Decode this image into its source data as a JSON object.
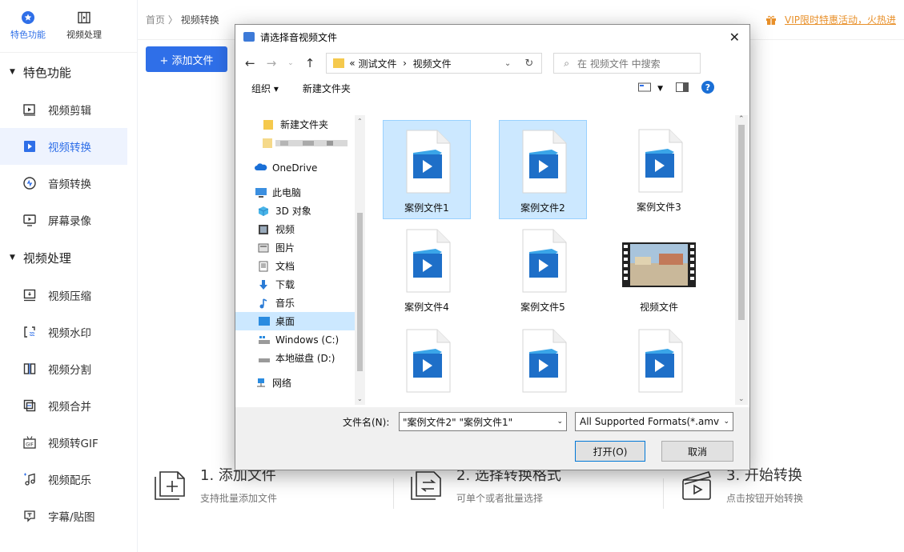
{
  "sidebar": {
    "tabs": [
      {
        "label": "特色功能",
        "icon": "star-icon"
      },
      {
        "label": "视频处理",
        "icon": "film-icon"
      }
    ],
    "section1": "特色功能",
    "section1_items": [
      {
        "label": "视频剪辑",
        "icon": "video-edit-icon"
      },
      {
        "label": "视频转换",
        "icon": "video-convert-icon"
      },
      {
        "label": "音频转换",
        "icon": "audio-convert-icon"
      },
      {
        "label": "屏幕录像",
        "icon": "screen-record-icon"
      }
    ],
    "section2": "视频处理",
    "section2_items": [
      {
        "label": "视频压缩",
        "icon": "compress-icon"
      },
      {
        "label": "视频水印",
        "icon": "watermark-icon"
      },
      {
        "label": "视频分割",
        "icon": "split-icon"
      },
      {
        "label": "视频合并",
        "icon": "merge-icon"
      },
      {
        "label": "视频转GIF",
        "icon": "gif-icon"
      },
      {
        "label": "视频配乐",
        "icon": "music-icon"
      },
      {
        "label": "字幕/贴图",
        "icon": "subtitle-icon"
      }
    ]
  },
  "header": {
    "breadcrumb_home": "首页",
    "breadcrumb_sep": "〉",
    "breadcrumb_current": "视频转换",
    "vip_text": "VIP限时特惠活动，火热进"
  },
  "main": {
    "add_file_label": "+ 添加文件",
    "steps": [
      {
        "title": "1. 添加文件",
        "desc": "支持批量添加文件"
      },
      {
        "title": "2. 选择转换格式",
        "desc": "可单个或者批量选择"
      },
      {
        "title": "3. 开始转换",
        "desc": "点击按钮开始转换"
      }
    ]
  },
  "dialog": {
    "title": "请选择音视频文件",
    "path_prefix": "«",
    "path_parts": [
      "测试文件",
      "›",
      "视频文件"
    ],
    "search_placeholder": "在 视频文件 中搜索",
    "organize_label": "组织 ▾",
    "new_folder_label": "新建文件夹",
    "tree": [
      {
        "label": "新建文件夹",
        "icon": "folder-icon"
      },
      {
        "label": "",
        "icon": "blurred-folder-icon"
      },
      {
        "label": "OneDrive",
        "icon": "cloud-icon"
      },
      {
        "label": "此电脑",
        "icon": "computer-icon"
      },
      {
        "label": "3D 对象",
        "icon": "cube-icon"
      },
      {
        "label": "视频",
        "icon": "video-folder-icon"
      },
      {
        "label": "图片",
        "icon": "picture-folder-icon"
      },
      {
        "label": "文档",
        "icon": "document-folder-icon"
      },
      {
        "label": "下载",
        "icon": "download-icon"
      },
      {
        "label": "音乐",
        "icon": "music-note-icon"
      },
      {
        "label": "桌面",
        "icon": "desktop-icon"
      },
      {
        "label": "Windows (C:)",
        "icon": "drive-c-icon"
      },
      {
        "label": "本地磁盘 (D:)",
        "icon": "drive-d-icon"
      },
      {
        "label": "网络",
        "icon": "network-icon"
      }
    ],
    "files": [
      {
        "name": "案例文件1",
        "selected": true,
        "thumb": "video-file-icon"
      },
      {
        "name": "案例文件2",
        "selected": true,
        "thumb": "video-file-icon"
      },
      {
        "name": "案例文件3",
        "selected": false,
        "thumb": "video-file-icon"
      },
      {
        "name": "案例文件4",
        "selected": false,
        "thumb": "video-file-icon"
      },
      {
        "name": "案例文件5",
        "selected": false,
        "thumb": "video-file-icon"
      },
      {
        "name": "视频文件",
        "selected": false,
        "thumb": "video-thumbnail"
      },
      {
        "name": "",
        "selected": false,
        "thumb": "video-file-icon"
      },
      {
        "name": "",
        "selected": false,
        "thumb": "video-file-icon"
      },
      {
        "name": "",
        "selected": false,
        "thumb": "video-file-icon"
      }
    ],
    "filename_label": "文件名(N):",
    "filename_value": "\"案例文件2\" \"案例文件1\"",
    "filetype_value": "All Supported Formats(*.amv",
    "open_label": "打开(O)",
    "cancel_label": "取消"
  },
  "colors": {
    "accent": "#2f6fe8",
    "selection": "#cce8ff",
    "vip": "#e8902a"
  }
}
